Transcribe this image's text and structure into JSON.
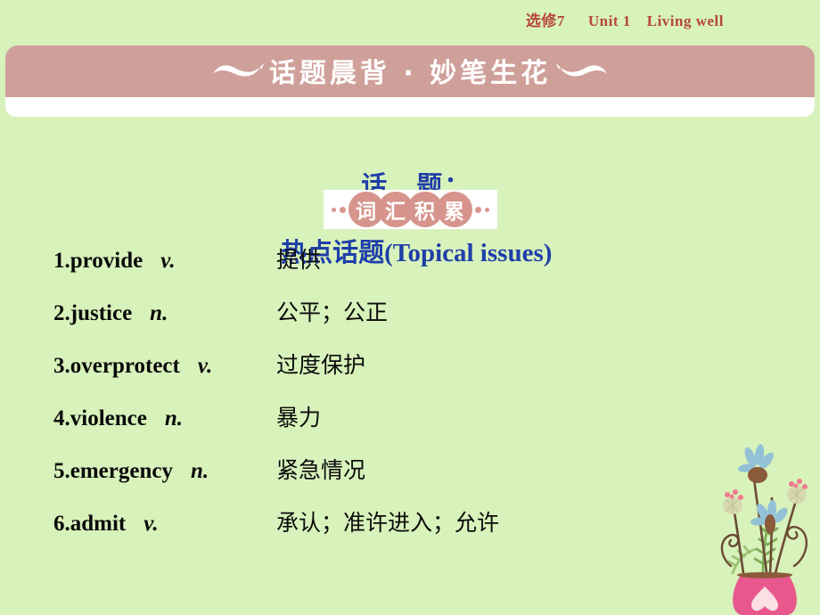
{
  "header": {
    "book": "选修7",
    "unit": "Unit 1",
    "lesson": "Living well"
  },
  "banner": {
    "title": "话题晨背 · 妙笔生花",
    "left_ornament": "wave-ornament",
    "right_ornament": "wave-ornament"
  },
  "topic": {
    "label": "话　题：",
    "value": "热点话题(Topical issues)"
  },
  "badge": {
    "chars": [
      "词",
      "汇",
      "积",
      "累"
    ],
    "full": "词汇积累"
  },
  "vocabulary": [
    {
      "num": "1.",
      "word": "provide",
      "pos": "v.",
      "meaning": "提供"
    },
    {
      "num": "2.",
      "word": "justice",
      "pos": "n.",
      "meaning": "公平；公正"
    },
    {
      "num": "3.",
      "word": "overprotect",
      "pos": "v.",
      "meaning": "过度保护"
    },
    {
      "num": "4.",
      "word": "violence",
      "pos": "n.",
      "meaning": "暴力"
    },
    {
      "num": "5.",
      "word": "emergency",
      "pos": "n.",
      "meaning": "紧急情况"
    },
    {
      "num": "6.",
      "word": "admit",
      "pos": "v.",
      "meaning": "承认；准许进入；允许"
    }
  ],
  "colors": {
    "page_background": "#d8f2bb",
    "banner": "#cfa09a",
    "header_text": "#b5473c",
    "topic_text": "#1f3fa8",
    "badge_circle": "#d6948c",
    "vase": "#e8588c"
  }
}
